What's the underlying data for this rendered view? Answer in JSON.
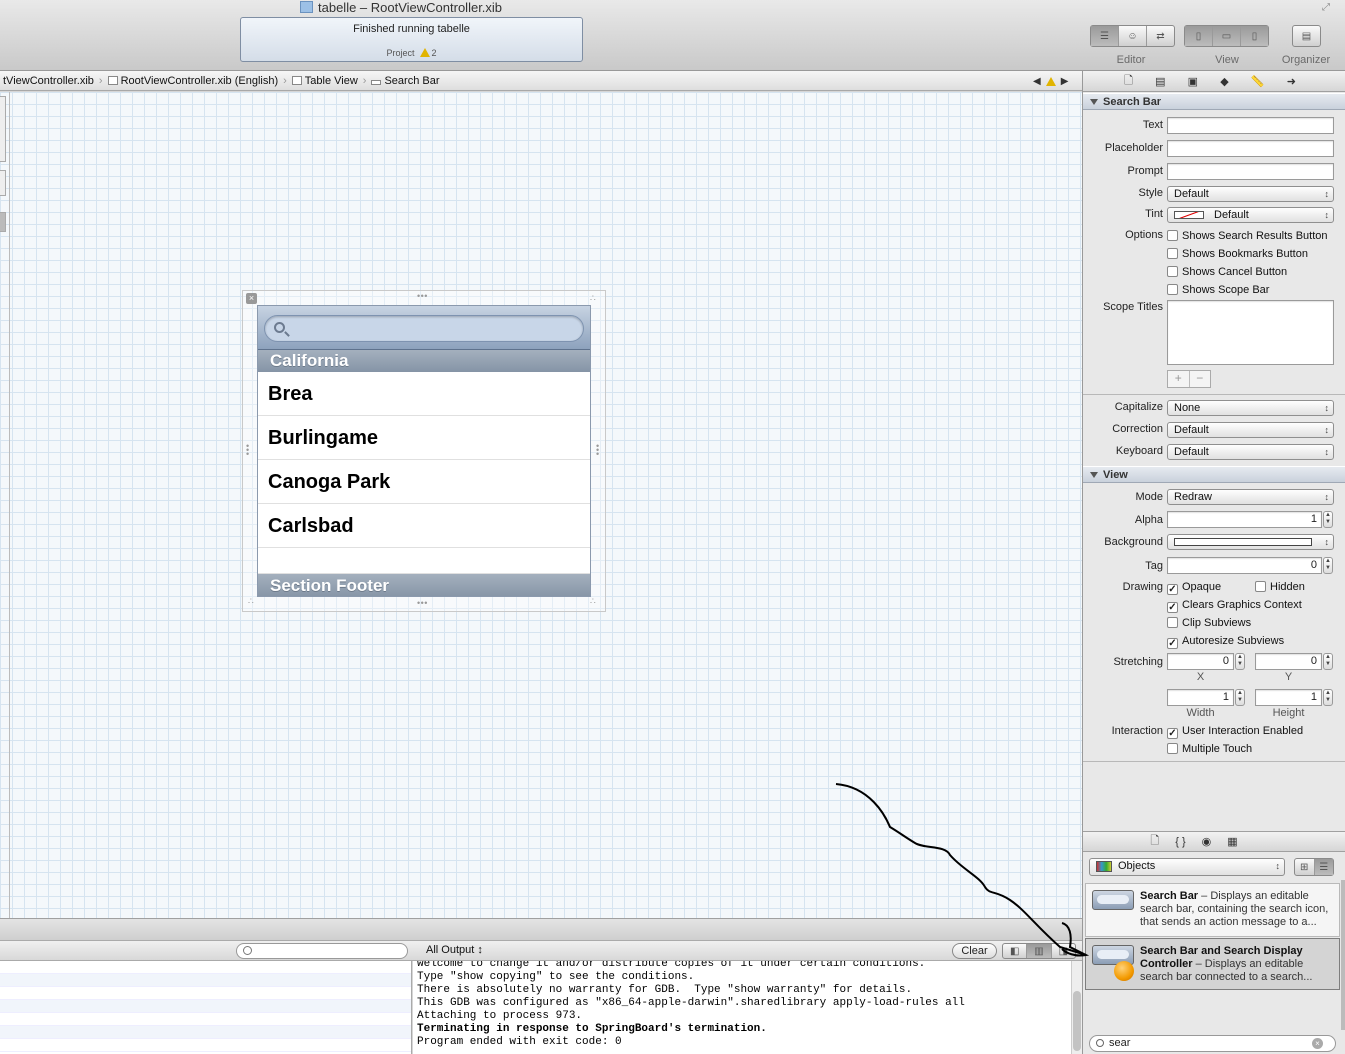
{
  "window": {
    "title": "tabelle – RootViewController.xib",
    "activity_status": "Finished running tabelle",
    "activity_project": "Project",
    "warning_count": "2"
  },
  "toolbar": {
    "editor_label": "Editor",
    "view_label": "View",
    "organizer_label": "Organizer"
  },
  "jumpbar": {
    "crumbs": [
      "tViewController.xib",
      "RootViewController.xib (English)",
      "Table View",
      "Search Bar"
    ]
  },
  "table_view": {
    "section_header": "California",
    "rows": [
      "Brea",
      "Burlingame",
      "Canoga Park",
      "Carlsbad"
    ],
    "section_footer": "Section Footer"
  },
  "inspector": {
    "search_bar_section": "Search Bar",
    "text_label": "Text",
    "placeholder_label": "Placeholder",
    "prompt_label": "Prompt",
    "style_label": "Style",
    "style_value": "Default",
    "tint_label": "Tint",
    "tint_value": "Default",
    "options_label": "Options",
    "options": [
      {
        "label": "Shows Search Results Button",
        "checked": false
      },
      {
        "label": "Shows Bookmarks Button",
        "checked": false
      },
      {
        "label": "Shows Cancel Button",
        "checked": false
      },
      {
        "label": "Shows Scope Bar",
        "checked": false
      }
    ],
    "scope_titles_label": "Scope Titles",
    "add_symbol": "+",
    "remove_symbol": "−",
    "capitalize_label": "Capitalize",
    "capitalize_value": "None",
    "correction_label": "Correction",
    "correction_value": "Default",
    "keyboard_label": "Keyboard",
    "keyboard_value": "Default",
    "view_section": "View",
    "mode_label": "Mode",
    "mode_value": "Redraw",
    "alpha_label": "Alpha",
    "alpha_value": "1",
    "background_label": "Background",
    "tag_label": "Tag",
    "tag_value": "0",
    "drawing_label": "Drawing",
    "opaque_label": "Opaque",
    "hidden_label": "Hidden",
    "clears_label": "Clears Graphics Context",
    "clip_label": "Clip Subviews",
    "autoresize_label": "Autoresize Subviews",
    "stretching_label": "Stretching",
    "stretch_x": "0",
    "stretch_y": "0",
    "x_label": "X",
    "y_label": "Y",
    "stretch_w": "1",
    "stretch_h": "1",
    "width_label": "Width",
    "height_label": "Height",
    "interaction_label": "Interaction",
    "user_interaction_label": "User Interaction Enabled",
    "multiple_touch_label": "Multiple Touch",
    "check_mark": "✓"
  },
  "library": {
    "popup_value": "Objects",
    "items": [
      {
        "title": "Search Bar",
        "desc": " – Displays an editable search bar, containing the search icon, that sends an action message to a..."
      },
      {
        "title": "Search Bar and Search Display Controller",
        "desc": " – Displays an editable search bar connected to a search..."
      }
    ],
    "filter_value": "sear"
  },
  "debug": {
    "output_select": "All Output",
    "clear_label": "Clear",
    "console_lines": [
      "welcome to change it and/or distribute copies of it under certain conditions.",
      "Type \"show copying\" to see the conditions.",
      "There is absolutely no warranty for GDB.  Type \"show warranty\" for details.",
      "This GDB was configured as \"x86_64-apple-darwin\".sharedlibrary apply-load-rules all",
      "Attaching to process 973."
    ],
    "console_bold": "Terminating in response to SpringBoard's termination.",
    "console_last": "Program ended with exit code: 0"
  }
}
